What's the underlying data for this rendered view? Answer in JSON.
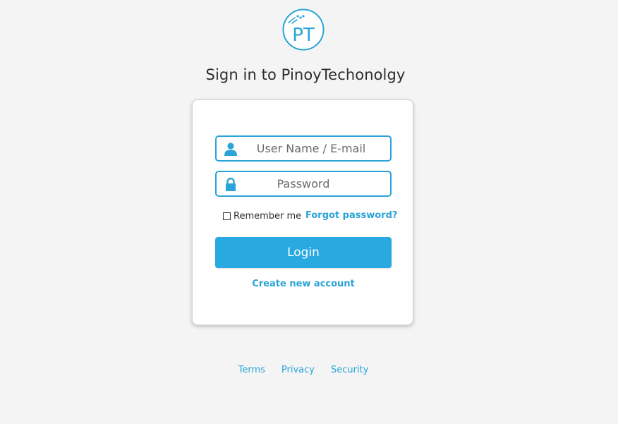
{
  "brand": {
    "logo_text": "PT",
    "accent_color": "#2aa3d8"
  },
  "header": {
    "title": "Sign in to PinoyTechonolgy"
  },
  "form": {
    "username_placeholder": "User Name / E-mail",
    "username_value": "",
    "password_placeholder": "Password",
    "password_value": "",
    "remember_label": "Remember me",
    "remember_checked": false,
    "forgot_label": "Forgot password?",
    "login_label": "Login",
    "create_account_label": "Create new account"
  },
  "icons": {
    "username": "user-icon",
    "password": "lock-icon"
  },
  "footer": {
    "links": [
      "Terms",
      "Privacy",
      "Security"
    ]
  }
}
